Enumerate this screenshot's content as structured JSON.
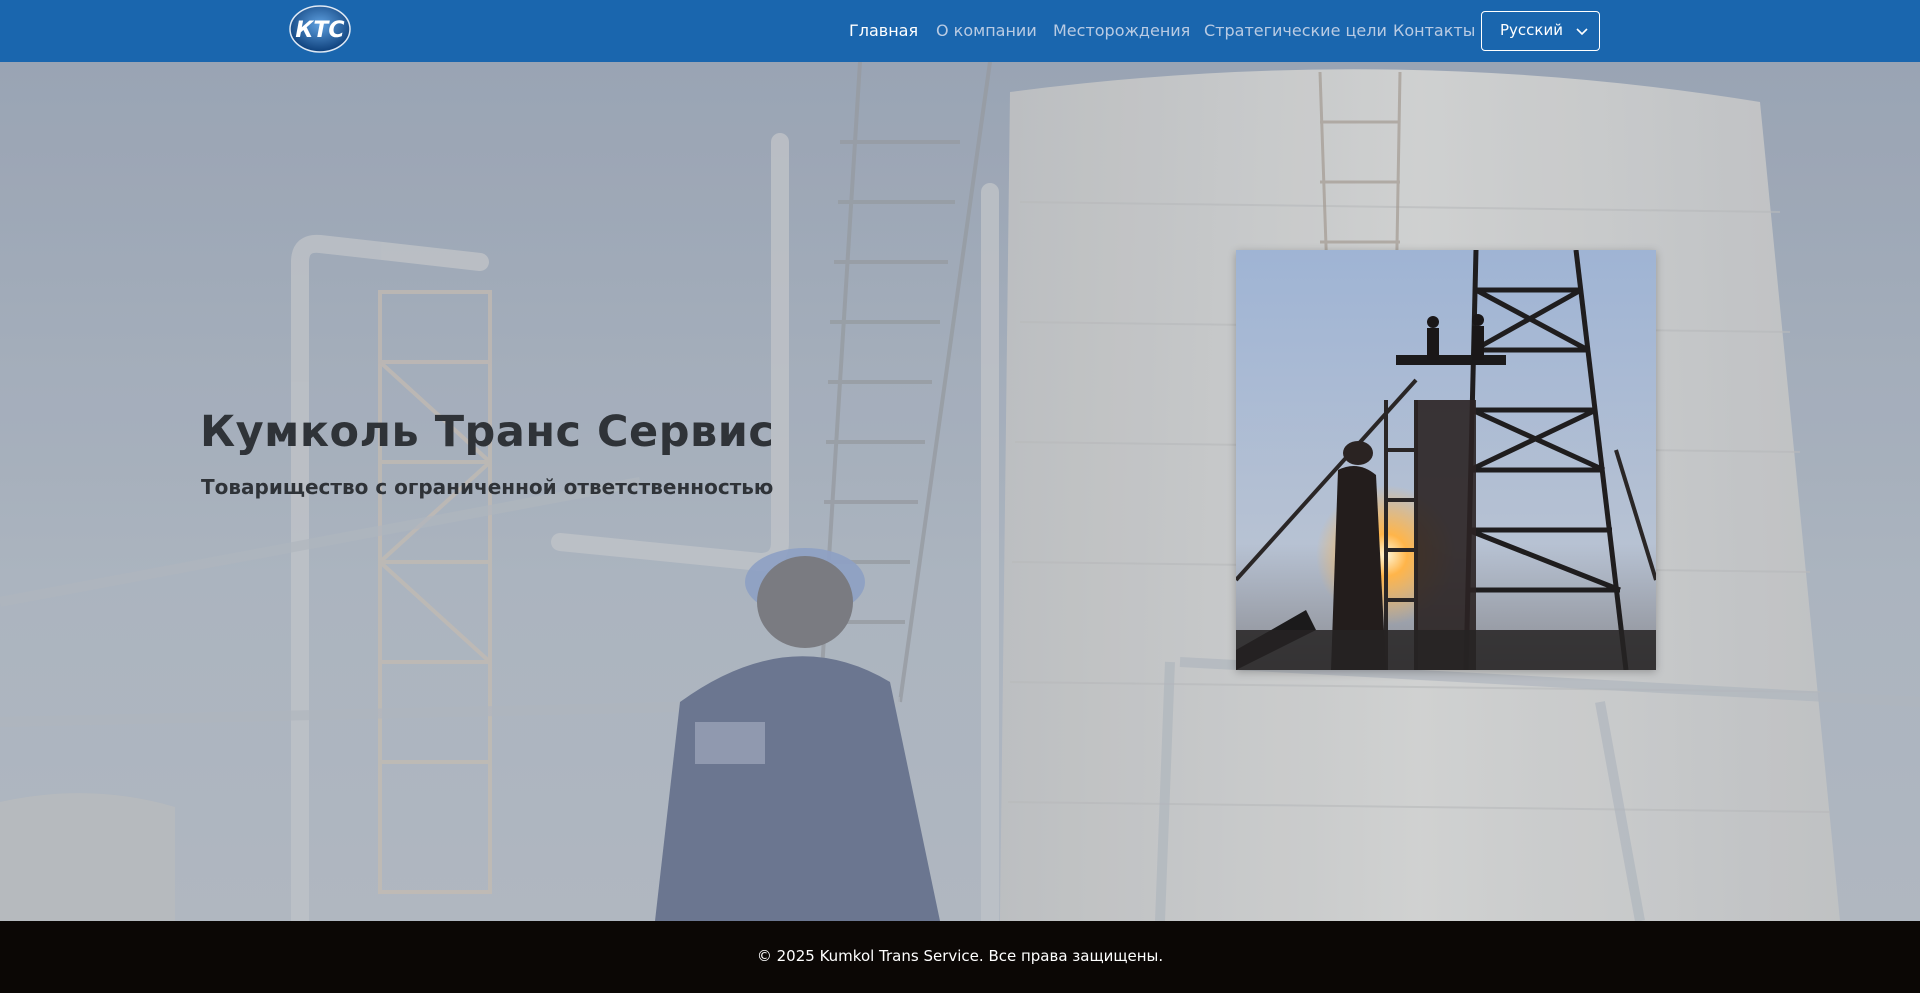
{
  "header": {
    "logo_text": "КТС",
    "nav": [
      {
        "label": "Главная",
        "active": true
      },
      {
        "label": "О компании",
        "active": false
      },
      {
        "label": "Месторождения",
        "active": false
      },
      {
        "label": "Стратегические цели",
        "active": false
      },
      {
        "label": "Контакты",
        "active": false
      }
    ],
    "language": {
      "selected": "Русский",
      "icon": "chevron-down-icon"
    }
  },
  "hero": {
    "title": "Кумколь Транс Сервис",
    "subtitle": "Товарищество с ограниченной ответственностью"
  },
  "footer": {
    "copyright": "© 2025 Kumkol Trans Service. Все права защищены."
  },
  "colors": {
    "navbar": "#1a66ae",
    "footer": "#0b0705",
    "heading": "#2f3338",
    "nav_inactive": "#b9cbe3",
    "nav_active": "#ffffff"
  }
}
